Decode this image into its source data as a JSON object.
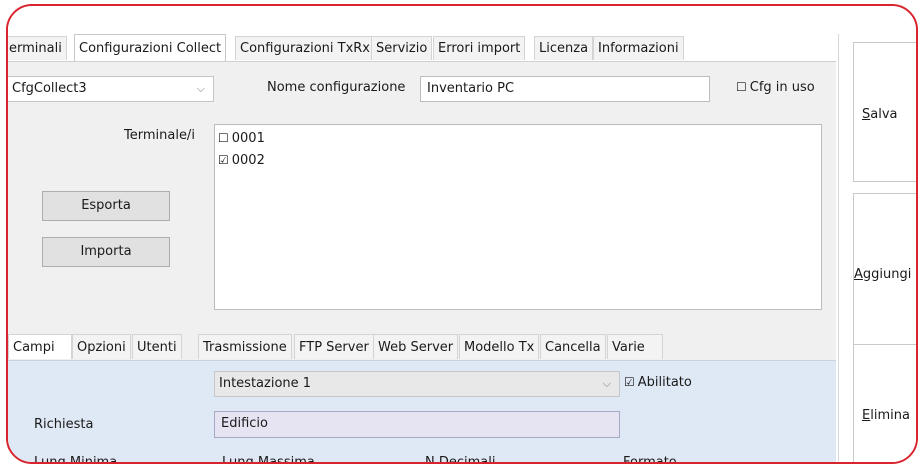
{
  "top_tabs": [
    "Terminali",
    "Configurazioni Collect",
    "Configurazioni TxRx",
    "Servizio",
    "Errori import",
    "Licenza",
    "Informazioni"
  ],
  "top_tabs_visible": [
    "erminali",
    "Configurazioni Collect",
    "Configurazioni TxRx",
    "Servizio",
    "Errori import",
    "Licenza",
    "Informazioni"
  ],
  "active_top_tab": "Configurazioni Collect",
  "config_select": {
    "value": "CfgCollect3"
  },
  "nome_configurazione": {
    "label": "Nome configurazione",
    "value": "Inventario PC"
  },
  "cfg_in_uso": {
    "label": "Cfg in uso",
    "checked": false
  },
  "terminali": {
    "label": "Terminale/i",
    "items": [
      {
        "id": "0001",
        "checked": false
      },
      {
        "id": "0002",
        "checked": true
      }
    ]
  },
  "buttons": {
    "esporta": "Esporta",
    "importa": "Importa"
  },
  "bottom_tabs": [
    "Campi",
    "Opzioni",
    "Utenti",
    "Trasmissione",
    "FTP Server",
    "Web Server",
    "Modello Tx",
    "Cancella",
    "Varie"
  ],
  "active_bottom_tab": "Campi",
  "campi": {
    "intestazione_select": "Intestazione 1",
    "abilitato": {
      "label": "Abilitato",
      "checked": true
    },
    "richiesta_label": "Richiesta",
    "richiesta_value": "Edificio",
    "columns": [
      "Lung.Minima",
      "Lung.Massima",
      "N.Decimali",
      "Formato"
    ]
  },
  "side_buttons": {
    "salva": {
      "underline": "S",
      "rest": "alva"
    },
    "aggiungi": {
      "underline": "A",
      "rest": "ggiungi"
    },
    "elimina": {
      "underline": "E",
      "rest": "limina"
    }
  },
  "icons": {
    "checkbox_unchecked": "☐",
    "checkbox_checked": "☑",
    "dropdown": "chevron-down"
  }
}
